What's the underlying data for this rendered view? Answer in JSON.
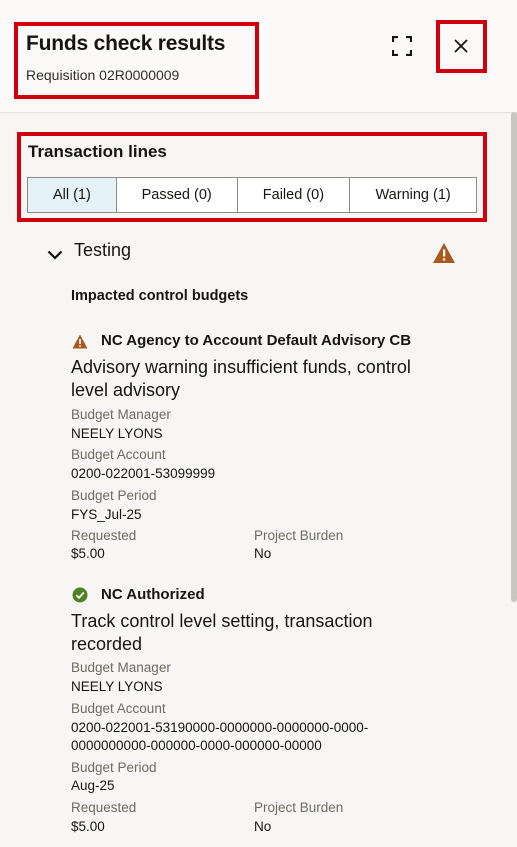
{
  "header": {
    "title": "Funds check results",
    "subtitle": "Requisition 02R0000009",
    "expand_icon": "expand-icon",
    "close_icon": "close-icon"
  },
  "transaction_lines": {
    "title": "Transaction lines",
    "tabs": [
      {
        "label": "All (1)",
        "active": true
      },
      {
        "label": "Passed (0)",
        "active": false
      },
      {
        "label": "Failed (0)",
        "active": false
      },
      {
        "label": "Warning (1)",
        "active": false
      }
    ]
  },
  "line": {
    "name": "Testing",
    "status_icon": "warning-icon",
    "impacted_heading": "Impacted control budgets",
    "budgets": [
      {
        "status_icon": "warning-icon",
        "name": "NC Agency to Account Default Advisory CB",
        "message_line1": "Advisory warning insufficient funds, control",
        "message_line2": "level advisory",
        "manager_label": "Budget Manager",
        "manager": "NEELY LYONS",
        "account_label": "Budget Account",
        "account_line1": "0200-022001-53099999",
        "period_label": "Budget Period",
        "period": "FYS_Jul-25",
        "requested_label": "Requested",
        "requested": "$5.00",
        "burden_label": "Project Burden",
        "burden": "No"
      },
      {
        "status_icon": "check-circle-icon",
        "name": "NC Authorized",
        "message_line1": "Track control level setting, transaction",
        "message_line2": "recorded",
        "manager_label": "Budget Manager",
        "manager": "NEELY LYONS",
        "account_label": "Budget Account",
        "account_line1": "0200-022001-53190000-0000000-0000000-0000-",
        "account_line2": "0000000000-000000-0000-000000-00000",
        "period_label": "Budget Period",
        "period": "Aug-25",
        "requested_label": "Requested",
        "requested": "$5.00",
        "burden_label": "Project Burden",
        "burden": "No"
      }
    ]
  },
  "colors": {
    "highlight": "#d1000f",
    "warning": "#a8591b",
    "success": "#508223",
    "active_tab": "#e4f1f7"
  }
}
